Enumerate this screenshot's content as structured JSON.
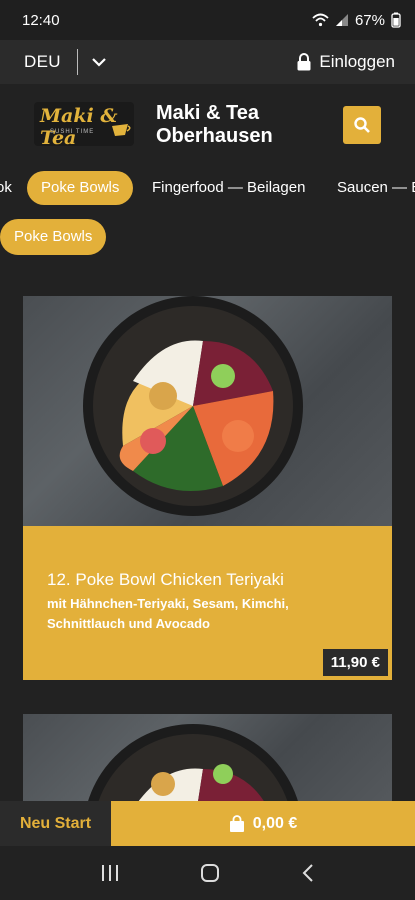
{
  "status": {
    "time": "12:40",
    "battery": "67%"
  },
  "topbar": {
    "language": "DEU",
    "login_label": "Einloggen"
  },
  "header": {
    "logo_text": "Maki & Tea",
    "logo_sub": "SUSHI TIME",
    "shop_line1": "Maki & Tea",
    "shop_line2": "Oberhausen"
  },
  "tabs": [
    {
      "label": "ok"
    },
    {
      "label": "Poke Bowls",
      "active": true
    },
    {
      "label": "Fingerfood — Beilagen"
    },
    {
      "label": "Saucen — E"
    }
  ],
  "section": {
    "chip_label": "Poke Bowls"
  },
  "products": [
    {
      "title": "12. Poke Bowl Chicken Teriyaki",
      "description": "mit Hähnchen-Teriyaki, Sesam, Kimchi, Schnittlauch und Avocado",
      "price": "11,90 €"
    }
  ],
  "bottom": {
    "restart_label": "Neu Start",
    "cart_total": "0,00 €"
  },
  "colors": {
    "accent": "#e3b03a",
    "background": "#222222",
    "bar": "#2b2b2b"
  }
}
